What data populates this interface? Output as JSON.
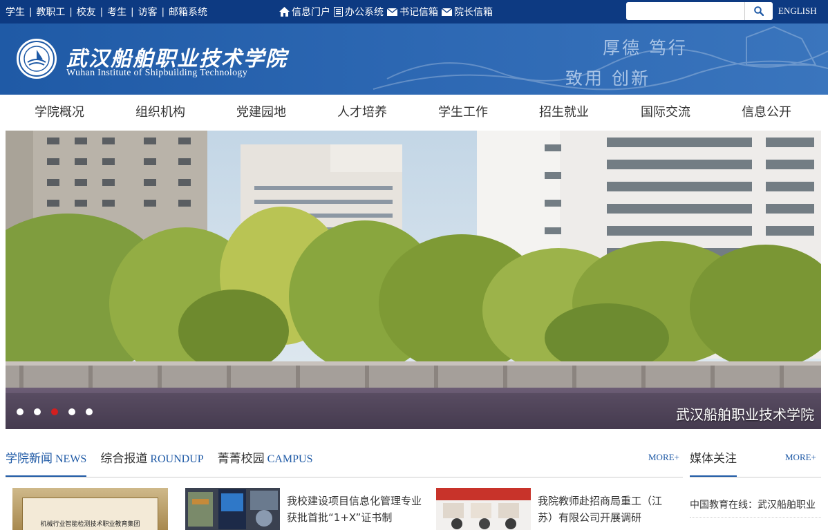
{
  "topbar": {
    "links": [
      "学生",
      "教职工",
      "校友",
      "考生",
      "访客",
      "邮箱系统"
    ],
    "separator": "|",
    "systems": [
      {
        "label": "信息门户",
        "icon": "home-icon"
      },
      {
        "label": "办公系统",
        "icon": "document-icon"
      },
      {
        "label": "书记信箱",
        "icon": "mail-icon"
      },
      {
        "label": "院长信箱",
        "icon": "mail-icon"
      }
    ],
    "search_placeholder": "",
    "english_label": "ENGLISH"
  },
  "header": {
    "name_cn": "武汉船舶职业技术学院",
    "name_en": "Wuhan Institute  of  Shipbuilding Technology",
    "motto_line1": "厚德  笃行",
    "motto_line2": "致用  创新"
  },
  "nav": {
    "items": [
      "学院概况",
      "组织机构",
      "党建园地",
      "人才培养",
      "学生工作",
      "招生就业",
      "国际交流",
      "信息公开"
    ]
  },
  "hero": {
    "caption": "武汉船舶职业技术学院",
    "slide_count": 5,
    "active_slide": 3
  },
  "news": {
    "tabs": [
      {
        "cn": "学院新闻",
        "en": "NEWS"
      },
      {
        "cn": "综合报道",
        "en": "ROUNDUP"
      },
      {
        "cn": "菁菁校园",
        "en": "CAMPUS"
      }
    ],
    "more_label": "MORE+",
    "plaque_text": "机械行业智能检测技术职业教育集团",
    "items": [
      {
        "title": "我校建设项目信息化管理专业获批首批“1+X”证书制"
      },
      {
        "title": "我院教师赴招商局重工（江苏）有限公司开展调研"
      }
    ]
  },
  "media": {
    "title": "媒体关注",
    "more_label": "MORE+",
    "items": [
      "中国教育在线：武汉船舶职业"
    ]
  },
  "colors": {
    "topbar": "#0d3a82",
    "header": "#2e69b4",
    "accent": "#1f5aa6",
    "active_dot": "#d31f1f"
  }
}
